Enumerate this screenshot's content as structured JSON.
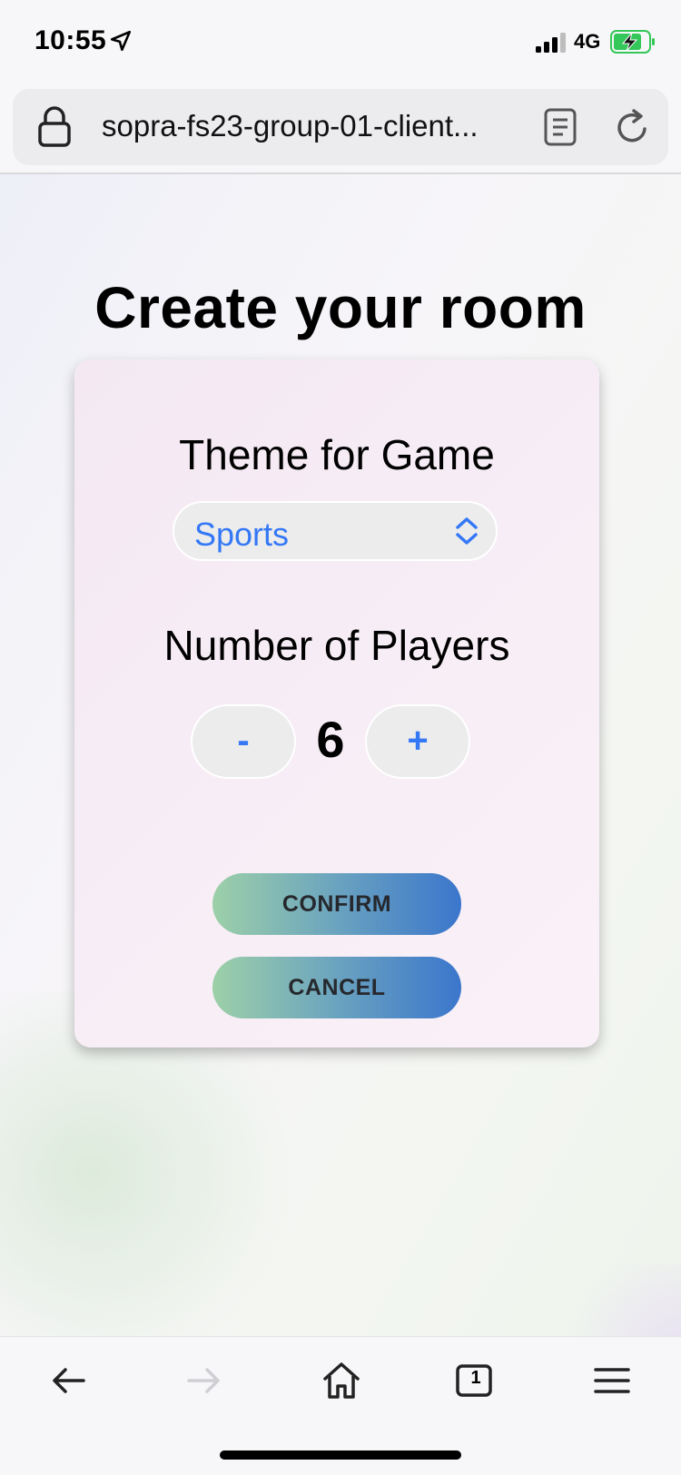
{
  "status_bar": {
    "time": "10:55",
    "network": "4G",
    "icons": [
      "location-arrow-icon",
      "signal-icon",
      "battery-charging-icon"
    ]
  },
  "browser": {
    "url": "sopra-fs23-group-01-client...",
    "icons": [
      "lock-icon",
      "reader-icon",
      "reload-icon"
    ]
  },
  "page": {
    "title": "Create your room",
    "theme_label": "Theme for Game",
    "theme_value": "Sports",
    "players_label": "Number of Players",
    "decrement_label": "-",
    "player_count": "6",
    "increment_label": "+",
    "confirm_label": "CONFIRM",
    "cancel_label": "CANCEL",
    "accent_color": "#3478f6"
  },
  "toolbar": {
    "tabs_count": "1",
    "icons": [
      "back-arrow-icon",
      "forward-arrow-icon",
      "home-icon",
      "tabs-icon",
      "menu-icon"
    ]
  }
}
